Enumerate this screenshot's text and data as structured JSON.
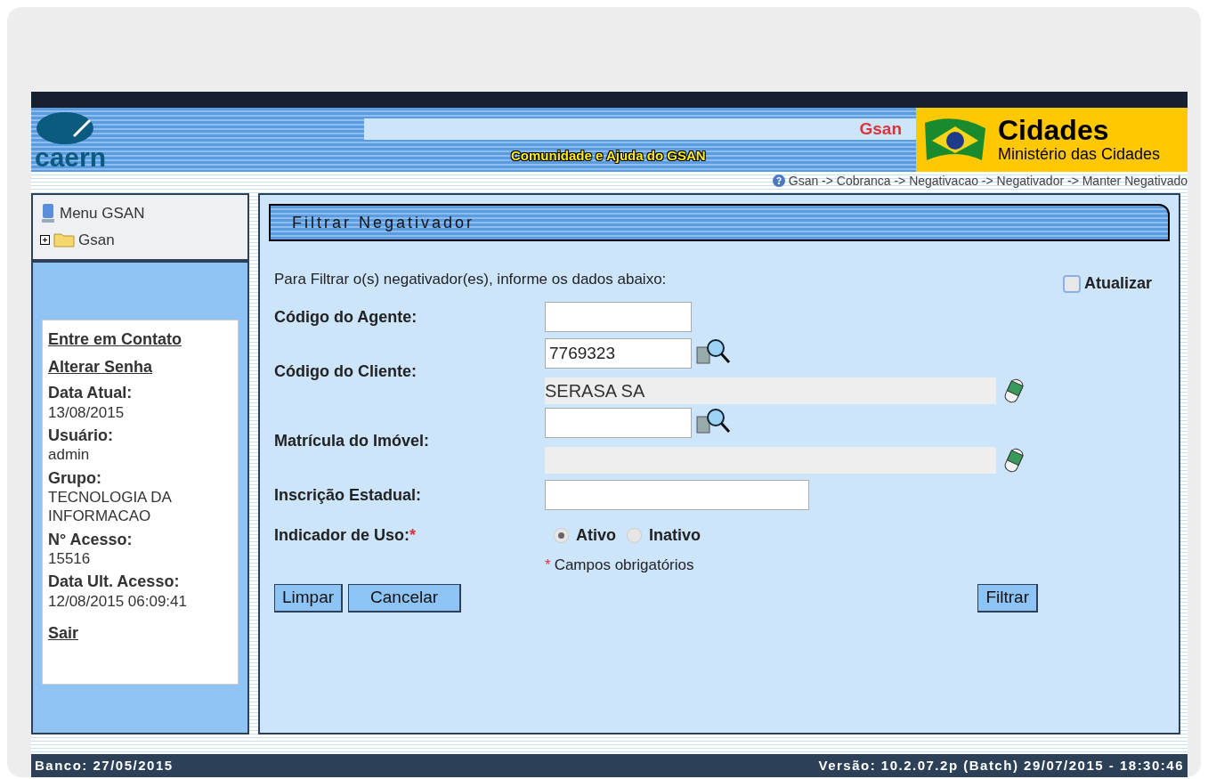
{
  "header": {
    "logo_text": "caern",
    "system_name": "Gsan",
    "help_link": "Comunidade e Ajuda do GSAN",
    "ministry_title": "Cidades",
    "ministry_subtitle": "Ministério das Cidades"
  },
  "breadcrumb": "Gsan -> Cobranca -> Negativacao -> Negativador -> Manter Negativado",
  "sidebar": {
    "menu_title": "Menu GSAN",
    "tree": [
      {
        "label": "Gsan",
        "expanded": false
      }
    ],
    "links": [
      "Entre em Contato",
      "Alterar Senha"
    ],
    "info": [
      {
        "label": "Data Atual:",
        "value": "13/08/2015"
      },
      {
        "label": "Usuário:",
        "value": "admin"
      },
      {
        "label": "Grupo:",
        "value": "TECNOLOGIA DA INFORMACAO"
      },
      {
        "label": "N° Acesso:",
        "value": "15516"
      },
      {
        "label": "Data Ult. Acesso:",
        "value": "12/08/2015 06:09:41"
      }
    ],
    "logout": "Sair"
  },
  "form": {
    "title": "Filtrar Negativador",
    "intro": "Para Filtrar o(s) negativador(es), informe os dados abaixo:",
    "refresh": {
      "label": "Atualizar",
      "checked": false
    },
    "fields": [
      {
        "kind": "text",
        "label": "Código do Agente:"
      },
      {
        "kind": "lookup",
        "label": "Código do Cliente:",
        "value": "7769323",
        "description": "SERASA SA"
      },
      {
        "kind": "lookup",
        "label": "Matrícula do Imóvel:"
      },
      {
        "kind": "wide",
        "label": "Inscrição Estadual:"
      },
      {
        "kind": "radio",
        "label": "Indicador de Uso:",
        "required_mark": "*",
        "options": [
          {
            "label": "Ativo",
            "selected": true
          },
          {
            "label": "Inativo",
            "selected": false
          }
        ]
      }
    ],
    "required_note": {
      "mark": "*",
      "text": "Campos obrigatórios"
    },
    "left_buttons": [
      "Limpar",
      "Cancelar"
    ],
    "right_button": "Filtrar"
  },
  "footer": {
    "left": "Banco: 27/05/2015",
    "right": "Versão: 10.2.07.2p (Batch) 29/07/2015 - 18:30:46"
  }
}
